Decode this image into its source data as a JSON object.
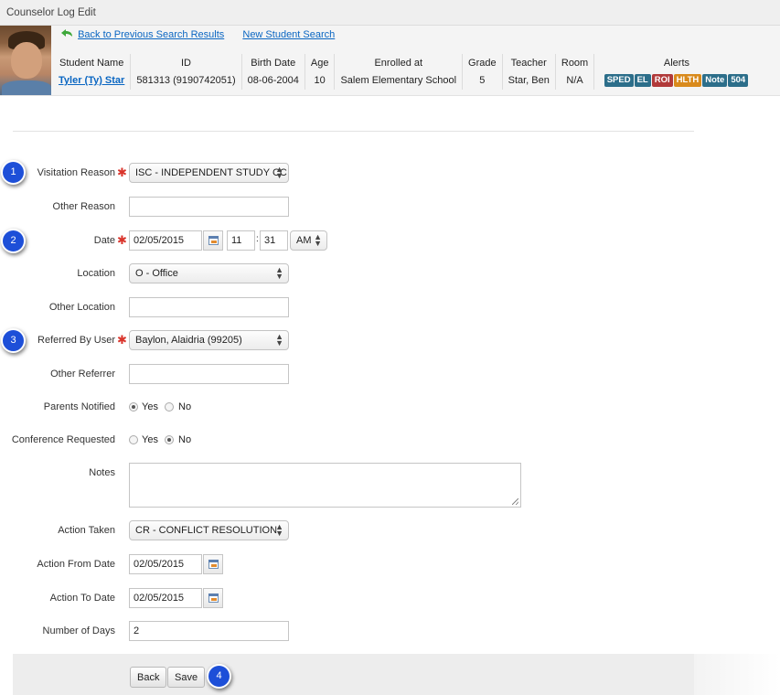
{
  "page": {
    "title": "Counselor Log Edit"
  },
  "nav": {
    "back_link": "Back to Previous Search Results",
    "new_search_link": "New Student Search"
  },
  "student": {
    "headers": [
      "Student Name",
      "ID",
      "Birth Date",
      "Age",
      "Enrolled at",
      "Grade",
      "Teacher",
      "Room",
      "Alerts"
    ],
    "name": "Tyler (Ty) Star",
    "id": "581313 (9190742051)",
    "birth_date": "08-06-2004",
    "age": "10",
    "enrolled_at": "Salem Elementary School",
    "grade": "5",
    "teacher": "Star, Ben",
    "room": "N/A",
    "alerts": [
      {
        "label": "SPED",
        "color": "#2c6e8a"
      },
      {
        "label": "EL",
        "color": "#2c6e8a"
      },
      {
        "label": "ROI",
        "color": "#b13a3a"
      },
      {
        "label": "HLTH",
        "color": "#d98a1c"
      },
      {
        "label": "Note",
        "color": "#2c6e8a"
      },
      {
        "label": "504",
        "color": "#2c6e8a"
      }
    ]
  },
  "form": {
    "visitation_reason": {
      "label": "Visitation Reason",
      "value": "ISC - INDEPENDENT STUDY CC",
      "required": true
    },
    "other_reason": {
      "label": "Other Reason",
      "value": ""
    },
    "date": {
      "label": "Date",
      "value": "02/05/2015",
      "hour": "11",
      "minute": "31",
      "ampm": "AM",
      "required": true
    },
    "location": {
      "label": "Location",
      "value": "O - Office"
    },
    "other_location": {
      "label": "Other Location",
      "value": ""
    },
    "referred_by": {
      "label": "Referred By User",
      "value": "Baylon, Alaidria (99205)",
      "required": true
    },
    "other_referrer": {
      "label": "Other Referrer",
      "value": ""
    },
    "parents_notified": {
      "label": "Parents Notified",
      "yes": "Yes",
      "no": "No",
      "selected": "Yes"
    },
    "conference_requested": {
      "label": "Conference Requested",
      "yes": "Yes",
      "no": "No",
      "selected": "No"
    },
    "notes": {
      "label": "Notes",
      "value": ""
    },
    "action_taken": {
      "label": "Action Taken",
      "value": "CR - CONFLICT RESOLUTION"
    },
    "action_from_date": {
      "label": "Action From Date",
      "value": "02/05/2015"
    },
    "action_to_date": {
      "label": "Action To Date",
      "value": "02/05/2015"
    },
    "number_of_days": {
      "label": "Number of Days",
      "value": "2"
    }
  },
  "buttons": {
    "back": "Back",
    "save": "Save"
  },
  "callouts": [
    "1",
    "2",
    "3",
    "4"
  ],
  "icons": {
    "required": "asterisk-icon",
    "select_arrow": "updown-arrow-icon",
    "calendar": "calendar-icon",
    "back": "green-back-arrow-icon"
  }
}
